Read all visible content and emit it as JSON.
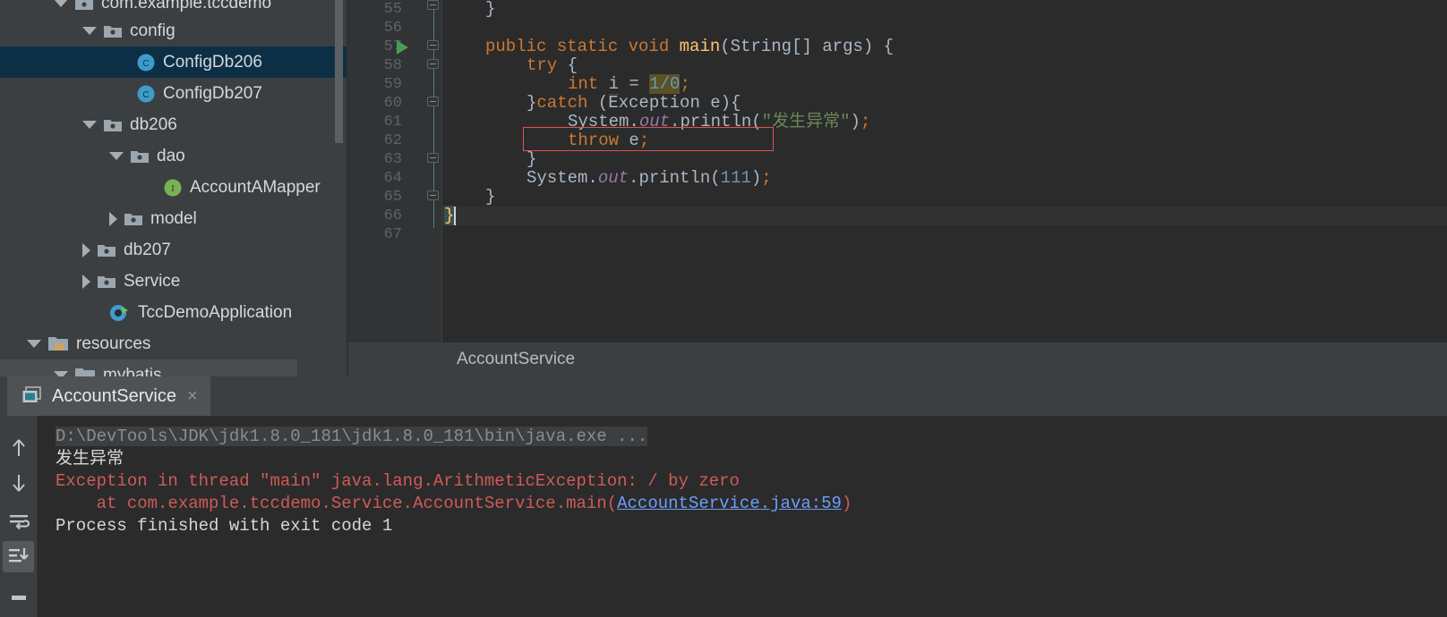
{
  "project_tree": {
    "items": [
      {
        "label": "com.example.tccdemo",
        "icon": "package-icon",
        "state": "expanded",
        "indent": 60,
        "clipped": true
      },
      {
        "label": "config",
        "icon": "package-icon",
        "state": "expanded",
        "indent": 92
      },
      {
        "label": "ConfigDb206",
        "icon": "class-icon",
        "state": "leaf",
        "indent": 152,
        "selected": true
      },
      {
        "label": "ConfigDb207",
        "icon": "class-icon",
        "state": "leaf",
        "indent": 152
      },
      {
        "label": "db206",
        "icon": "package-icon",
        "state": "expanded",
        "indent": 92
      },
      {
        "label": "dao",
        "icon": "package-icon",
        "state": "expanded",
        "indent": 122
      },
      {
        "label": "AccountAMapper",
        "icon": "interface-icon",
        "state": "leaf",
        "indent": 182
      },
      {
        "label": "model",
        "icon": "package-icon",
        "state": "collapsed",
        "indent": 122
      },
      {
        "label": "db207",
        "icon": "package-icon",
        "state": "collapsed",
        "indent": 92
      },
      {
        "label": "Service",
        "icon": "package-icon",
        "state": "collapsed",
        "indent": 92
      },
      {
        "label": "TccDemoApplication",
        "icon": "spring-class-icon",
        "state": "leaf",
        "indent": 122
      },
      {
        "label": "resources",
        "icon": "resources-folder-icon",
        "state": "expanded",
        "indent": 30
      },
      {
        "label": "mybatis",
        "icon": "resources-folder-icon",
        "state": "expanded",
        "indent": 60,
        "hover": true
      }
    ]
  },
  "editor": {
    "line_numbers": [
      "55",
      "56",
      "57",
      "58",
      "59",
      "60",
      "61",
      "62",
      "63",
      "64",
      "65",
      "66",
      "67"
    ],
    "first_line_number": 55,
    "run_marker_line": 57,
    "caret_line": 66,
    "error_box_line": 62,
    "code_lines": [
      {
        "num": 55,
        "text": "    }"
      },
      {
        "num": 56,
        "text": ""
      },
      {
        "num": 57,
        "text": "    public static void main(String[] args) {"
      },
      {
        "num": 58,
        "text": "        try {"
      },
      {
        "num": 59,
        "text": "            int i = 1/0;"
      },
      {
        "num": 60,
        "text": "        }catch (Exception e){"
      },
      {
        "num": 61,
        "text": "            System.out.println(\"发生异常\");"
      },
      {
        "num": 62,
        "text": "            throw e;"
      },
      {
        "num": 63,
        "text": "        }"
      },
      {
        "num": 64,
        "text": "        System.out.println(111);"
      },
      {
        "num": 65,
        "text": "    }"
      },
      {
        "num": 66,
        "text": "}"
      },
      {
        "num": 67,
        "text": ""
      }
    ],
    "breadcrumb": "AccountService"
  },
  "run_panel": {
    "tab": {
      "title": "AccountService",
      "icon": "run-configuration-icon",
      "close_label": "×"
    },
    "toolbar": [
      {
        "name": "up-icon",
        "label": "↑",
        "active": false
      },
      {
        "name": "down-icon",
        "label": "↓",
        "active": false
      },
      {
        "name": "soft-wrap-icon",
        "label": "",
        "active": false
      },
      {
        "name": "scroll-to-end-icon",
        "label": "",
        "active": true
      },
      {
        "name": "print-icon",
        "label": "",
        "active": false
      }
    ],
    "console_lines": [
      {
        "text": "D:\\DevTools\\JDK\\jdk1.8.0_181\\jdk1.8.0_181\\bin\\java.exe ...",
        "style": "system"
      },
      {
        "text": "发生异常",
        "style": "out"
      },
      {
        "text": "Exception in thread \"main\" java.lang.ArithmeticException: / by zero",
        "style": "error"
      },
      {
        "text": "    at com.example.tccdemo.Service.AccountService.main(",
        "style": "error",
        "link": "AccountService.java:59",
        "suffix": ")"
      },
      {
        "text": "",
        "style": "out"
      },
      {
        "text": "Process finished with exit code 1",
        "style": "out"
      }
    ]
  },
  "colors": {
    "editor_bg": "#2b2b2b",
    "panel_bg": "#3c3f41",
    "selection_bg": "#0d2f45",
    "keyword": "#cc7832",
    "string": "#6a8759",
    "number": "#6897bb",
    "field": "#9876aa",
    "method": "#ffc66d",
    "error_red": "#cf5b56",
    "link_blue": "#6c9ef8",
    "run_green": "#499c54"
  }
}
